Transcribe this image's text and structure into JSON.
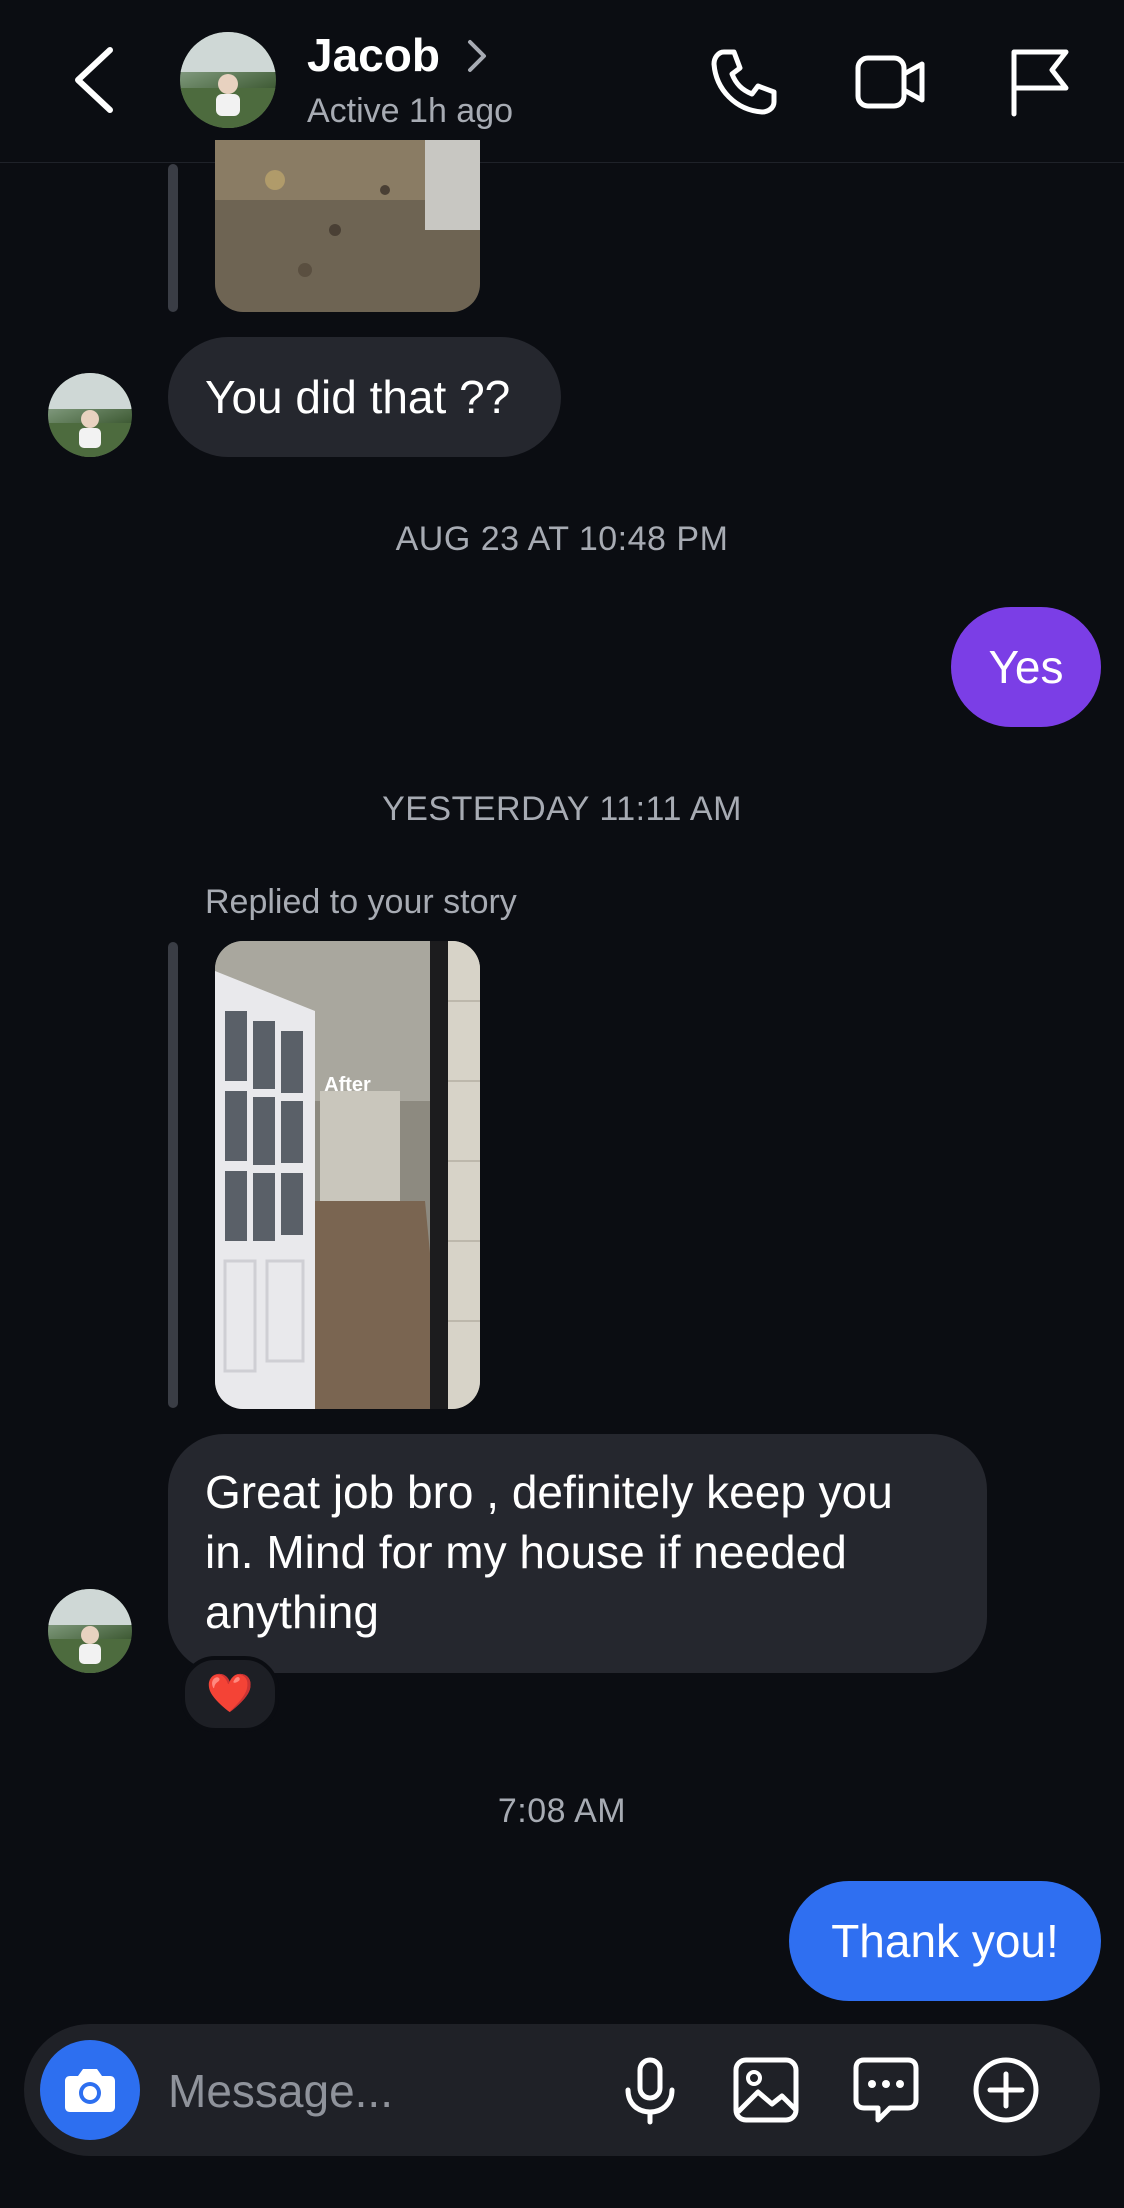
{
  "header": {
    "name": "Jacob",
    "status": "Active 1h ago",
    "icons": [
      "back-chevron-icon",
      "chevron-right-icon",
      "phone-icon",
      "video-camera-icon",
      "flag-icon"
    ]
  },
  "messages": {
    "m1_text": "You did that ??",
    "ts1": "AUG 23 AT 10:48 PM",
    "m2_text": "Yes",
    "ts2": "YESTERDAY 11:11 AM",
    "story_reply_label": "Replied to your story",
    "story_overlay": "After",
    "m3_text": "Great job bro , definitely keep you in. Mind for my house if needed anything",
    "reaction": "❤️",
    "ts3": "7:08 AM",
    "m4_text": "Thank you!"
  },
  "composer": {
    "placeholder": "Message...",
    "icons": [
      "camera-icon",
      "microphone-icon",
      "gallery-icon",
      "sticker-chat-icon",
      "plus-circle-icon"
    ]
  },
  "colors": {
    "background": "#0b0d12",
    "incoming_bubble": "#25272e",
    "outgoing_purple": "#7b3ee6",
    "outgoing_blue": "#2f6ff1",
    "camera_button": "#2d6ff0"
  }
}
